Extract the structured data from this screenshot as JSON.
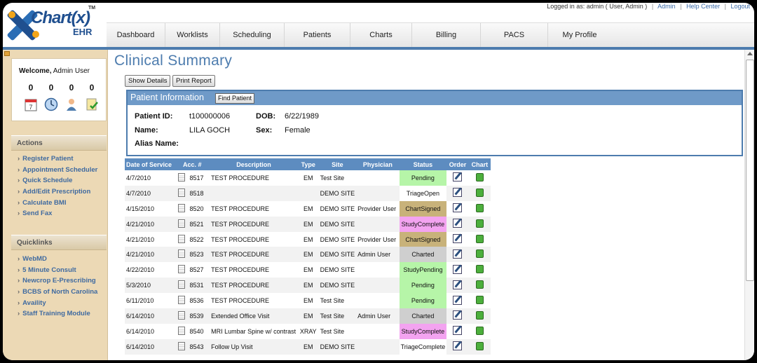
{
  "logo": {
    "name": "Chart(x)",
    "sub": "EHR",
    "tm": "TM"
  },
  "loginbar": {
    "logged_in_text": "Logged in as: admin ( User, Admin )",
    "links": [
      "Admin",
      "Help Center",
      "Logout"
    ]
  },
  "nav": {
    "tabs": [
      "Dashboard",
      "Worklists",
      "Scheduling",
      "Patients",
      "Charts",
      "Billing",
      "PACS",
      "My Profile"
    ]
  },
  "sidebar": {
    "welcome_label": "Welcome,",
    "welcome_user": "Admin User",
    "counts": [
      "0",
      "0",
      "0",
      "0"
    ],
    "actions_title": "Actions",
    "actions": [
      "Register Patient",
      "Appointment Scheduler",
      "Quick Schedule",
      "Add/Edit Prescription",
      "Calculate BMI",
      "Send Fax"
    ],
    "quicklinks_title": "Quicklinks",
    "quicklinks": [
      "WebMD",
      "5 Minute Consult",
      "Newcrop E-Prescribing",
      "BCBS of North Carolina",
      "Availity",
      "Staff Training Module"
    ]
  },
  "main": {
    "title": "Clinical Summary",
    "show_details": "Show Details",
    "print_report": "Print Report",
    "patient_info_title": "Patient Information",
    "find_patient": "Find Patient",
    "patient": {
      "id_label": "Patient ID:",
      "id": "t100000006",
      "dob_label": "DOB:",
      "dob": "6/22/1989",
      "name_label": "Name:",
      "name": "LILA GOCH",
      "sex_label": "Sex:",
      "sex": "Female",
      "alias_label": "Alias Name:",
      "alias": ""
    },
    "table": {
      "headers": [
        "Date of Service",
        "Acc. #",
        "Description",
        "Type",
        "Site",
        "Physician",
        "Status",
        "Order",
        "Chart"
      ],
      "rows": [
        {
          "date": "4/7/2010",
          "acc": "8517",
          "desc": "TEST PROCEDURE",
          "type": "EM",
          "site": "Test Site",
          "phys": "",
          "status": "Pending",
          "color": "#b6f5a8"
        },
        {
          "date": "4/7/2010",
          "acc": "8518",
          "desc": "",
          "type": "",
          "site": "DEMO SITE",
          "phys": "",
          "status": "TriageOpen",
          "color": "#ffffff"
        },
        {
          "date": "4/15/2010",
          "acc": "8520",
          "desc": "TEST PROCEDURE",
          "type": "EM",
          "site": "DEMO SITE",
          "phys": "Provider User",
          "status": "ChartSigned",
          "color": "#c8b27a"
        },
        {
          "date": "4/21/2010",
          "acc": "8521",
          "desc": "TEST PROCEDURE",
          "type": "EM",
          "site": "DEMO SITE",
          "phys": "",
          "status": "StudyComplete",
          "color": "#f3a3f0"
        },
        {
          "date": "4/21/2010",
          "acc": "8522",
          "desc": "TEST PROCEDURE",
          "type": "EM",
          "site": "DEMO SITE",
          "phys": "Provider User",
          "status": "ChartSigned",
          "color": "#c8b27a"
        },
        {
          "date": "4/21/2010",
          "acc": "8523",
          "desc": "TEST PROCEDURE",
          "type": "EM",
          "site": "DEMO SITE",
          "phys": "Admin User",
          "status": "Charted",
          "color": "#cfcfcf"
        },
        {
          "date": "4/22/2010",
          "acc": "8527",
          "desc": "TEST PROCEDURE",
          "type": "EM",
          "site": "DEMO SITE",
          "phys": "",
          "status": "StudyPending",
          "color": "#b6f5a8"
        },
        {
          "date": "5/3/2010",
          "acc": "8531",
          "desc": "TEST PROCEDURE",
          "type": "EM",
          "site": "DEMO SITE",
          "phys": "",
          "status": "Pending",
          "color": "#b6f5a8"
        },
        {
          "date": "6/11/2010",
          "acc": "8536",
          "desc": "TEST PROCEDURE",
          "type": "EM",
          "site": "Test Site",
          "phys": "",
          "status": "Pending",
          "color": "#b6f5a8"
        },
        {
          "date": "6/14/2010",
          "acc": "8539",
          "desc": "Extended Office Visit",
          "type": "EM",
          "site": "Test Site",
          "phys": "Admin User",
          "status": "Charted",
          "color": "#cfcfcf"
        },
        {
          "date": "6/14/2010",
          "acc": "8540",
          "desc": "MRI Lumbar Spine w/ contrast",
          "type": "XRAY",
          "site": "Test Site",
          "phys": "",
          "status": "StudyComplete",
          "color": "#f3a3f0"
        },
        {
          "date": "6/14/2010",
          "acc": "8543",
          "desc": "Follow Up Visit",
          "type": "EM",
          "site": "DEMO SITE",
          "phys": "",
          "status": "TriageComplete",
          "color": "#ffffff"
        }
      ]
    }
  }
}
